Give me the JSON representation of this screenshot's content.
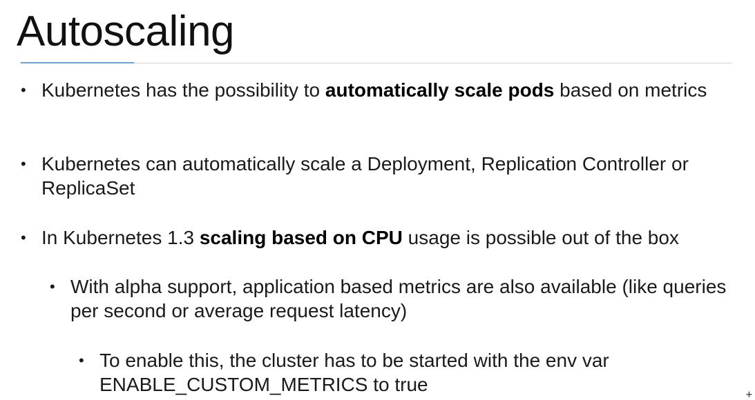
{
  "slide": {
    "title": "Autoscaling",
    "bullets": [
      {
        "level": 1,
        "parts": [
          {
            "text": "Kubernetes has the possibility to ",
            "bold": false
          },
          {
            "text": "automatically scale pods",
            "bold": true
          },
          {
            "text": " based on metrics",
            "bold": false
          }
        ]
      },
      {
        "level": 1,
        "parts": [
          {
            "text": "Kubernetes can automatically scale a Deployment, Replication Controller or ReplicaSet",
            "bold": false
          }
        ]
      },
      {
        "level": 1,
        "parts": [
          {
            "text": "In Kubernetes 1.3 ",
            "bold": false
          },
          {
            "text": "scaling based on CPU",
            "bold": true
          },
          {
            "text": " usage is possible out of the box",
            "bold": false
          }
        ]
      },
      {
        "level": 2,
        "parts": [
          {
            "text": "With alpha support, application based metrics are also available (like queries per second or average request latency)",
            "bold": false
          }
        ]
      },
      {
        "level": 3,
        "parts": [
          {
            "text": "To enable this, the cluster has to be started with the env var ENABLE_CUSTOM_METRICS to true",
            "bold": false
          }
        ]
      }
    ],
    "bullet_glyph": "•"
  },
  "colors": {
    "accent_rule": "#6f9fc8",
    "rule": "#d5d5d5",
    "text": "#1a1a1a"
  },
  "cursor_icon": "crosshair-cursor-icon"
}
